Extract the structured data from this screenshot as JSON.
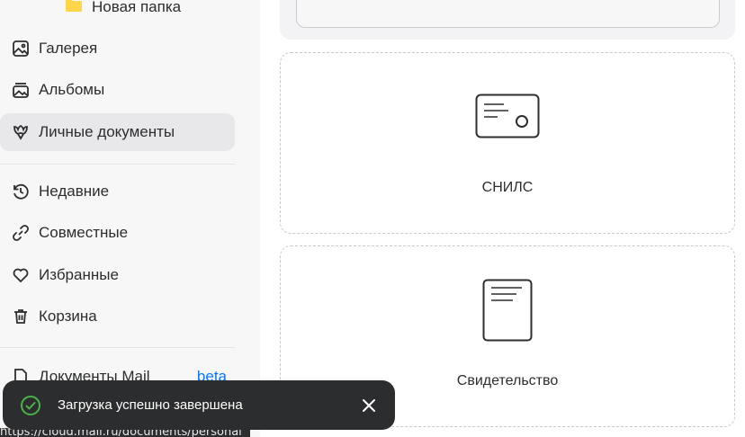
{
  "sidebar": {
    "folder": {
      "label": "Новая папка",
      "icon": "folder-icon",
      "color": "#ffd64a"
    },
    "items": [
      {
        "label": "Галерея",
        "icon": "gallery-icon"
      },
      {
        "label": "Альбомы",
        "icon": "albums-icon"
      },
      {
        "label": "Личные документы",
        "icon": "documents-icon",
        "active": true
      },
      {
        "label": "Недавние",
        "icon": "history-icon"
      },
      {
        "label": "Совместные",
        "icon": "link-icon"
      },
      {
        "label": "Избранные",
        "icon": "heart-icon"
      },
      {
        "label": "Корзина",
        "icon": "trash-icon"
      },
      {
        "label": "Документы Mail",
        "icon": "document-icon",
        "badge": "beta"
      }
    ]
  },
  "cards": [
    {
      "title": "СНИЛС",
      "icon": "snils-card-icon"
    },
    {
      "title": "Свидетельство",
      "icon": "certificate-icon"
    }
  ],
  "toast": {
    "message": "Загрузка успешно завершена",
    "icon": "check-circle-icon",
    "accent": "#4bb34b"
  },
  "status_url": "https://cloud.mail.ru/documents/personal",
  "colors": {
    "link": "#0077ff",
    "active_bg": "#e8e8ea",
    "toast_bg": "#2c2d2e"
  }
}
